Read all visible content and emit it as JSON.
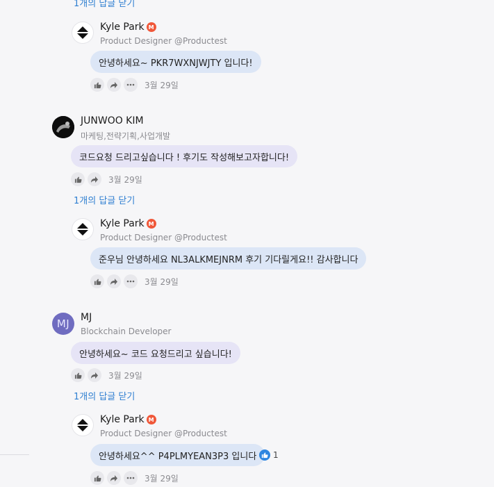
{
  "toggle_label": "1개의 답글 닫기",
  "reply_author": {
    "name": "Kyle Park",
    "badge": "M",
    "subtitle": "Product Designer @Productest"
  },
  "comments": [
    {
      "name": "JUNWOO KIM",
      "subtitle": "마케팅,전략기획,사업개발",
      "text": "코드요청 드리고싶습니다 ! 후기도 작성해보고자합니다!",
      "date": "3월 29일"
    },
    {
      "name": "MJ",
      "avatar_initials": "MJ",
      "subtitle": "Blockchain Developer",
      "text": "안녕하세요~ 코드 요청드리고 싶습니다!",
      "date": "3월 29일"
    }
  ],
  "replies": [
    {
      "text": "안녕하세요~ PKR7WXNJWJTY 입니다!",
      "date": "3월 29일"
    },
    {
      "text": "준우님 안녕하세요 NL3ALKMEJNRM 후기 기다릴게요!! 감사합니다",
      "date": "3월 29일"
    },
    {
      "text": "안녕하세요^^ P4PLMYEAN3P3 입니다",
      "date": "3월 29일",
      "like_count": "1"
    }
  ],
  "colors": {
    "link": "#2f7fd1",
    "reply_bubble": "#dce6f6",
    "comment_bubble": "#e6e4f6",
    "badge": "#f0583a",
    "like": "#2f86e0"
  },
  "icons": [
    "thumbs-up-icon",
    "share-arrow-icon",
    "more-icon",
    "m-badge-icon",
    "like-reaction-icon",
    "brand-logo-icon"
  ]
}
